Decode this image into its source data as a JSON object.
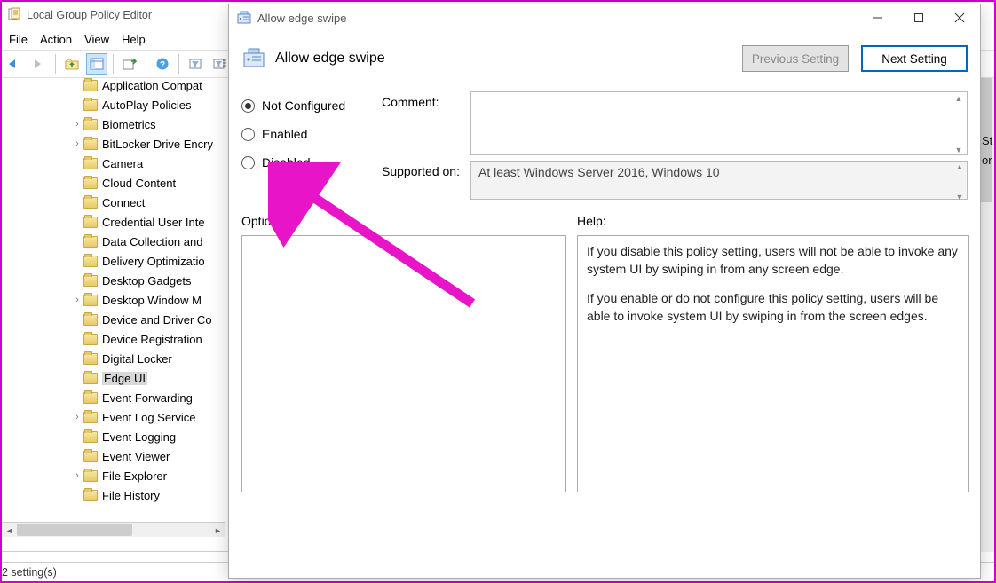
{
  "gp": {
    "title": "Local Group Policy Editor",
    "menu": [
      "File",
      "Action",
      "View",
      "Help"
    ],
    "statusbar": "2 setting(s)",
    "tree": [
      {
        "label": "Application Compat",
        "indent": 92,
        "expander": ""
      },
      {
        "label": "AutoPlay Policies",
        "indent": 92,
        "expander": ""
      },
      {
        "label": "Biometrics",
        "indent": 92,
        "expander": "›"
      },
      {
        "label": "BitLocker Drive Encry",
        "indent": 92,
        "expander": "›"
      },
      {
        "label": "Camera",
        "indent": 92,
        "expander": ""
      },
      {
        "label": "Cloud Content",
        "indent": 92,
        "expander": ""
      },
      {
        "label": "Connect",
        "indent": 92,
        "expander": ""
      },
      {
        "label": "Credential User Inte",
        "indent": 92,
        "expander": ""
      },
      {
        "label": "Data Collection and",
        "indent": 92,
        "expander": ""
      },
      {
        "label": "Delivery Optimizatio",
        "indent": 92,
        "expander": ""
      },
      {
        "label": "Desktop Gadgets",
        "indent": 92,
        "expander": ""
      },
      {
        "label": "Desktop Window M",
        "indent": 92,
        "expander": "›"
      },
      {
        "label": "Device and Driver Co",
        "indent": 92,
        "expander": ""
      },
      {
        "label": "Device Registration",
        "indent": 92,
        "expander": ""
      },
      {
        "label": "Digital Locker",
        "indent": 92,
        "expander": ""
      },
      {
        "label": "Edge UI",
        "indent": 92,
        "expander": "",
        "selected": true
      },
      {
        "label": "Event Forwarding",
        "indent": 92,
        "expander": ""
      },
      {
        "label": "Event Log Service",
        "indent": 92,
        "expander": "›"
      },
      {
        "label": "Event Logging",
        "indent": 92,
        "expander": ""
      },
      {
        "label": "Event Viewer",
        "indent": 92,
        "expander": ""
      },
      {
        "label": "File Explorer",
        "indent": 92,
        "expander": "›"
      },
      {
        "label": "File History",
        "indent": 92,
        "expander": ""
      }
    ]
  },
  "right_snips": [
    "St",
    "or",
    ""
  ],
  "dialog": {
    "title": "Allow edge swipe",
    "heading": "Allow edge swipe",
    "prev_btn": "Previous Setting",
    "next_btn": "Next Setting",
    "radios": {
      "not_configured": "Not Configured",
      "enabled": "Enabled",
      "disabled": "Disabled"
    },
    "comment_label": "Comment:",
    "comment_value": "",
    "supported_label": "Supported on:",
    "supported_value": "At least Windows Server 2016, Windows 10",
    "options_label": "Options:",
    "help_label": "Help:",
    "help_p1": "If you disable this policy setting, users will not be able to invoke any system UI by swiping in from any screen edge.",
    "help_p2": "If you enable or do not configure this policy setting, users will be able to invoke system UI by swiping in from the screen edges."
  }
}
